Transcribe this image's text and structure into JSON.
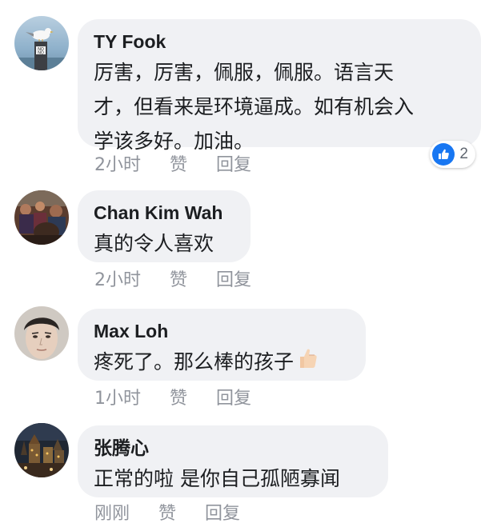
{
  "colors": {
    "bubble": "#f0f1f4",
    "text": "#1c1e21",
    "meta": "#90949c",
    "like_blue": "#1877f2"
  },
  "comments": [
    {
      "author": "TY Fook",
      "text_lines": [
        "厉害，厉害，佩服，佩服。语言天",
        "才，但看来是环境逼成。如有机会入",
        "学该多好。加油。"
      ],
      "time": "2小时",
      "like_label": "赞",
      "reply_label": "回复",
      "reaction_icon": "thumbs-up-icon",
      "reaction_count": "2",
      "avatar_icon": "seagull-on-post-avatar",
      "avatar_sign_text": [
        "NO",
        "NO"
      ]
    },
    {
      "author": "Chan Kim Wah",
      "text_lines": [
        "真的令人喜欢"
      ],
      "time": "2小时",
      "like_label": "赞",
      "reply_label": "回复",
      "avatar_icon": "crowd-photo-avatar"
    },
    {
      "author": "Max Loh",
      "text_lines": [
        "疼死了。那么棒的孩子"
      ],
      "emoji": "thumbs-up-emoji",
      "time": "1小时",
      "like_label": "赞",
      "reply_label": "回复",
      "avatar_icon": "face-photo-avatar"
    },
    {
      "author": "张腾心",
      "text_lines": [
        "正常的啦 是你自己孤陋寡闻"
      ],
      "time": "刚刚",
      "like_label": "赞",
      "reply_label": "回复",
      "avatar_icon": "night-city-avatar"
    }
  ]
}
